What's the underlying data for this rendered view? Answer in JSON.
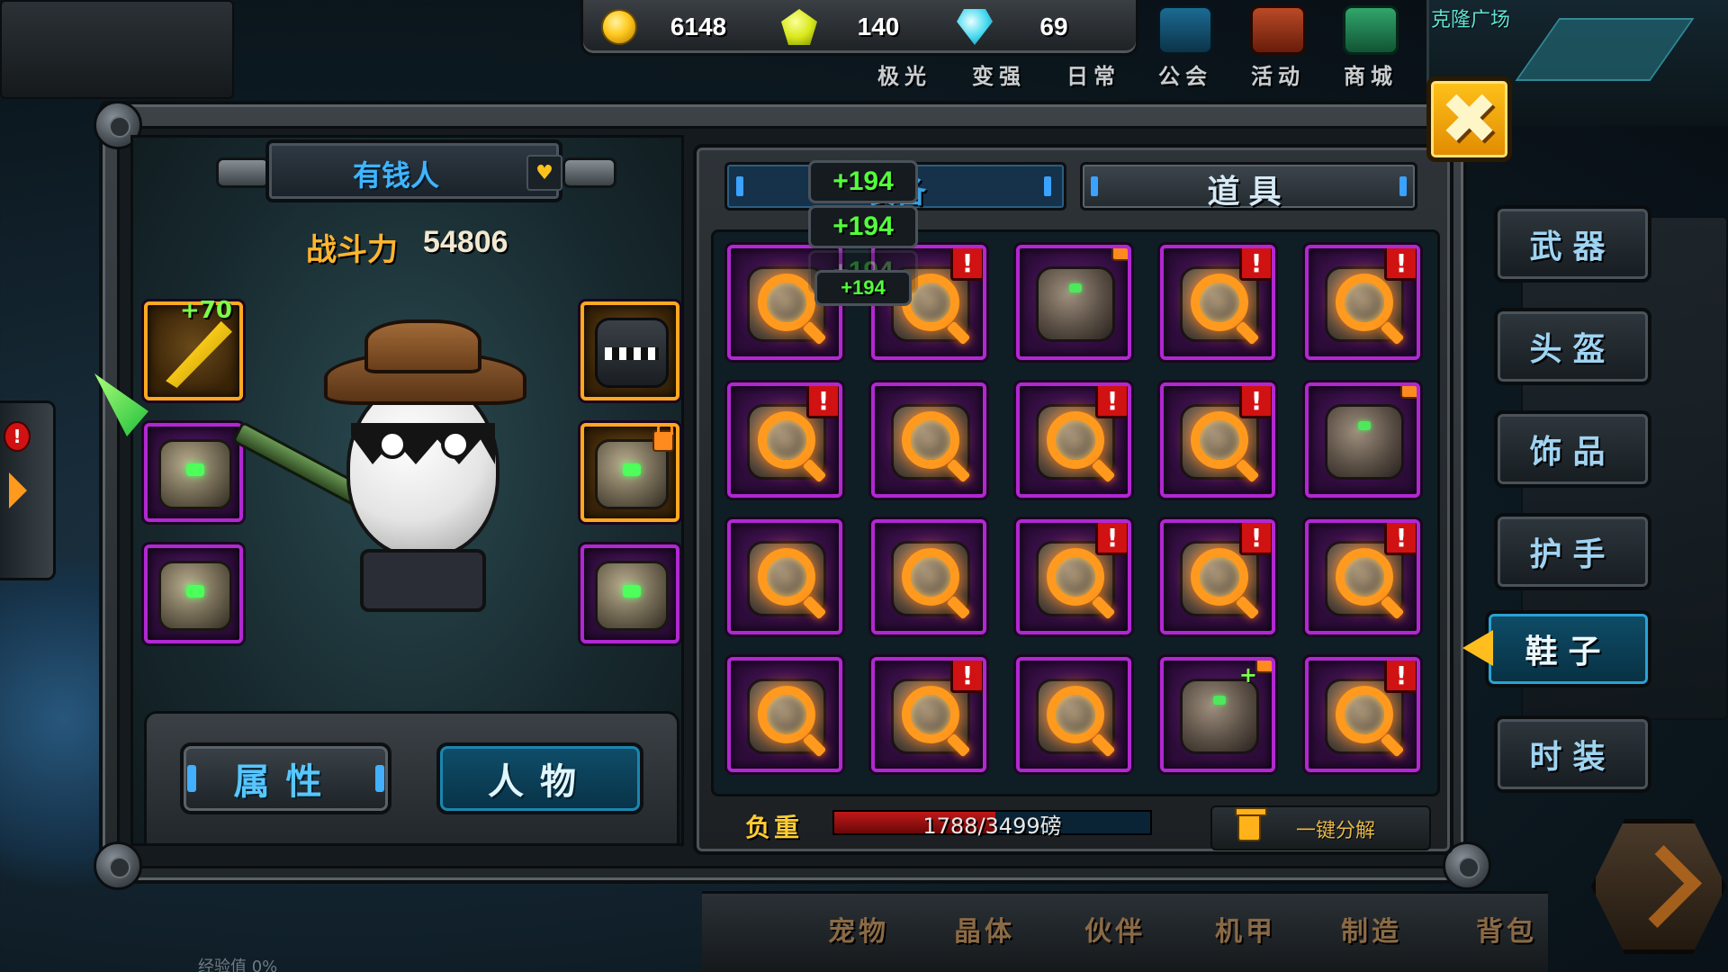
{
  "currency": {
    "gold": "6148",
    "yellow_gem": "140",
    "diamond": "69"
  },
  "top_nav": [
    {
      "label": "极光",
      "icon": "aurora-icon"
    },
    {
      "label": "变强",
      "icon": "power-up-icon"
    },
    {
      "label": "日常",
      "icon": "daily-icon"
    },
    {
      "label": "公会",
      "icon": "guild-fist-icon"
    },
    {
      "label": "活动",
      "icon": "event-gift-icon"
    },
    {
      "label": "商城",
      "icon": "shop-cart-icon"
    }
  ],
  "minimap": {
    "label": "克隆广场"
  },
  "character": {
    "name": "有钱人",
    "power_label": "战斗力",
    "power_value": "54806",
    "weapon_bonus": "+70"
  },
  "bottom_left": {
    "attributes_label": "属性",
    "character_label": "人物"
  },
  "inventory": {
    "tab_equipment": "装备",
    "tab_items": "道具",
    "weight_label": "负重",
    "weight_text": "1788/3499磅",
    "weight_current": 1788,
    "weight_max": 3499,
    "salvage_label": "一键分解",
    "popups": [
      "+194",
      "+194",
      "+194",
      "+194"
    ]
  },
  "categories": [
    "武器",
    "头盔",
    "饰品",
    "护手",
    "鞋子",
    "时装"
  ],
  "active_category": "鞋子",
  "bottom_nav": [
    "宠物",
    "晶体",
    "伙伴",
    "机甲",
    "制造",
    "背包"
  ],
  "exp_text": "经验值 0%",
  "close_label": "✖"
}
